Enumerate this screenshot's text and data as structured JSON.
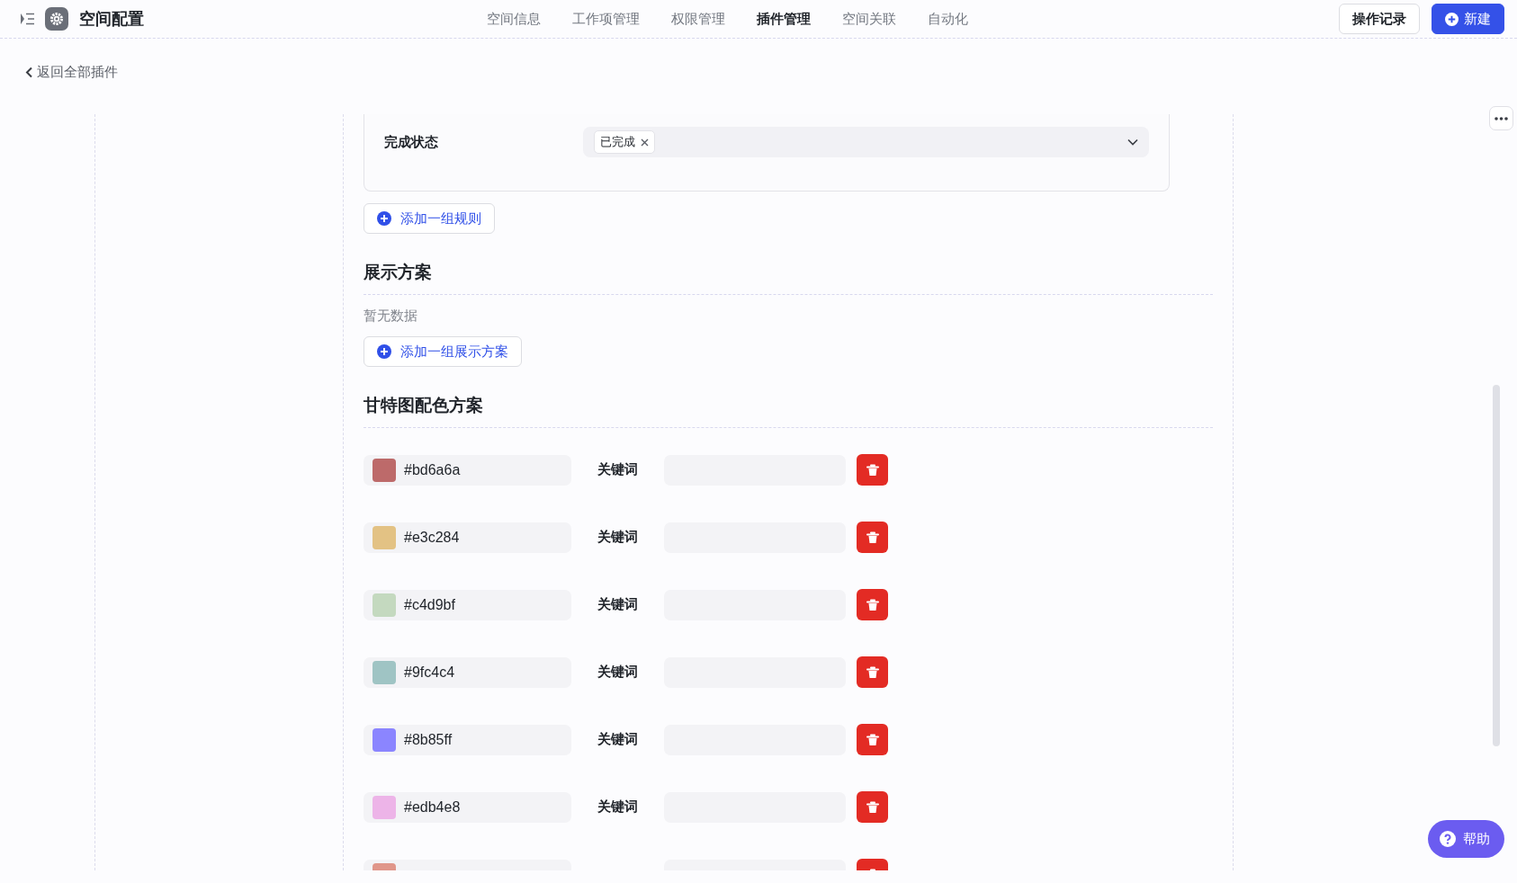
{
  "header": {
    "title": "空间配置",
    "tabs": [
      {
        "label": "空间信息",
        "selected": false
      },
      {
        "label": "工作项管理",
        "selected": false
      },
      {
        "label": "权限管理",
        "selected": false
      },
      {
        "label": "插件管理",
        "selected": true
      },
      {
        "label": "空间关联",
        "selected": false
      },
      {
        "label": "自动化",
        "selected": false
      }
    ],
    "buttons": [
      {
        "label": "操作记录",
        "kind": "secondary"
      },
      {
        "label": "新建",
        "kind": "primary"
      }
    ]
  },
  "back_link": "返回全部插件",
  "rule_group": {
    "field_label": "完成状态",
    "tags": [
      "已完成"
    ]
  },
  "add_rule_button": "添加一组规则",
  "display_section": {
    "title": "展示方案",
    "empty_text": "暂无数据",
    "add_button": "添加一组展示方案"
  },
  "color_section": {
    "title": "甘特图配色方案",
    "rows": [
      {
        "color": "#bd6a6a",
        "hex": "#bd6a6a",
        "label": "关键词"
      },
      {
        "color": "#e3c284",
        "hex": "#e3c284",
        "label": "关键词"
      },
      {
        "color": "#c4d9bf",
        "hex": "#c4d9bf",
        "label": "关键词"
      },
      {
        "color": "#9fc4c4",
        "hex": "#9fc4c4",
        "label": "关键词"
      },
      {
        "color": "#8b85ff",
        "hex": "#8b85ff",
        "label": "关键词"
      },
      {
        "color": "#edb4e8",
        "hex": "#edb4e8",
        "label": "关键词"
      },
      {
        "color": "#e0968a"
      }
    ]
  },
  "help_button": "帮助"
}
